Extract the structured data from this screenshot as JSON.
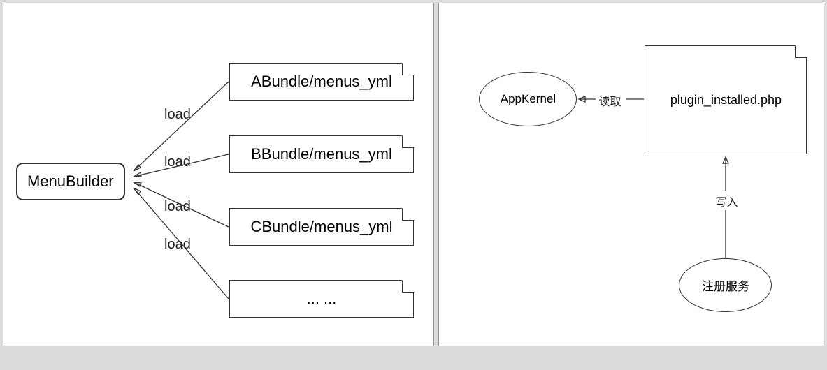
{
  "left": {
    "builder": "MenuBuilder",
    "edge_label": "load",
    "files": [
      "ABundle/menus_yml",
      "BBundle/menus_yml",
      "CBundle/menus_yml",
      "... ..."
    ]
  },
  "right": {
    "kernel": "AppKernel",
    "file": "plugin_installed.php",
    "service": "注册服务",
    "edge_read": "读取",
    "edge_write": "写入"
  },
  "chart_data": [
    {
      "type": "diagram",
      "title": "",
      "nodes": [
        {
          "id": "menubuilder",
          "label": "MenuBuilder",
          "shape": "rounded-rect"
        },
        {
          "id": "a",
          "label": "ABundle/menus_yml",
          "shape": "file"
        },
        {
          "id": "b",
          "label": "BBundle/menus_yml",
          "shape": "file"
        },
        {
          "id": "c",
          "label": "CBundle/menus_yml",
          "shape": "file"
        },
        {
          "id": "more",
          "label": "... ...",
          "shape": "file"
        }
      ],
      "edges": [
        {
          "from": "a",
          "to": "menubuilder",
          "label": "load",
          "arrow": "to"
        },
        {
          "from": "b",
          "to": "menubuilder",
          "label": "load",
          "arrow": "to"
        },
        {
          "from": "c",
          "to": "menubuilder",
          "label": "load",
          "arrow": "to"
        },
        {
          "from": "more",
          "to": "menubuilder",
          "label": "load",
          "arrow": "to"
        }
      ]
    },
    {
      "type": "diagram",
      "title": "",
      "nodes": [
        {
          "id": "appkernel",
          "label": "AppKernel",
          "shape": "ellipse"
        },
        {
          "id": "plugin",
          "label": "plugin_installed.php",
          "shape": "file"
        },
        {
          "id": "service",
          "label": "注册服务",
          "shape": "ellipse"
        }
      ],
      "edges": [
        {
          "from": "plugin",
          "to": "appkernel",
          "label": "读取",
          "arrow": "to"
        },
        {
          "from": "service",
          "to": "plugin",
          "label": "写入",
          "arrow": "to"
        }
      ]
    }
  ]
}
